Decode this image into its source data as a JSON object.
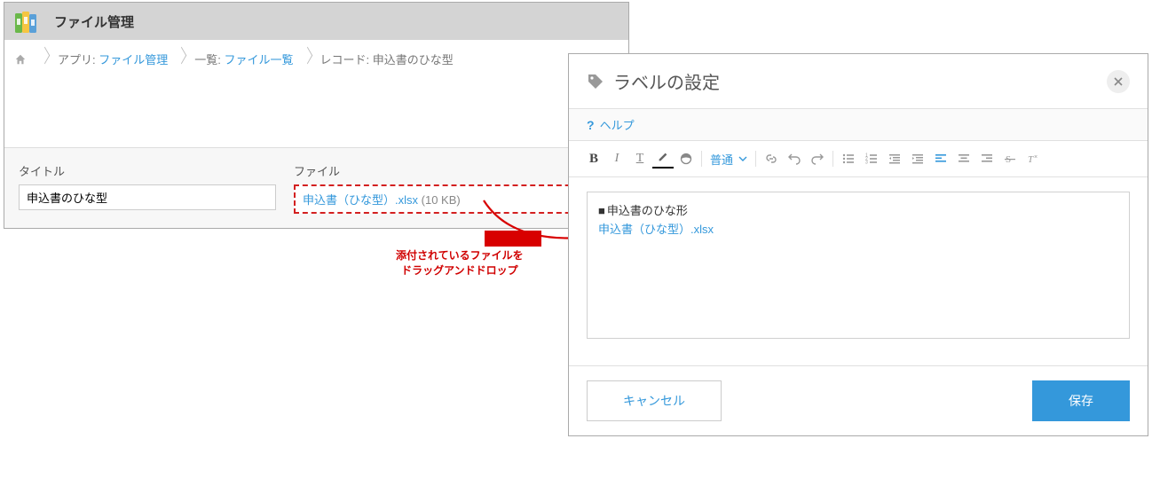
{
  "header": {
    "title": "ファイル管理"
  },
  "breadcrumb": {
    "app_label": "アプリ: ",
    "app_link": "ファイル管理",
    "list_label": "一覧: ",
    "list_link": "ファイル一覧",
    "record_label": "レコード: 申込書のひな型"
  },
  "form": {
    "title_label": "タイトル",
    "title_value": "申込書のひな型",
    "file_label": "ファイル",
    "file_name": "申込書（ひな型）.xlsx",
    "file_size": "(10 KB)"
  },
  "caption": {
    "line1": "添付されているファイルを",
    "line2": "ドラッグアンドドロップ"
  },
  "dialog": {
    "title": "ラベルの設定",
    "help": "ヘルプ",
    "font_size": "普通",
    "editor_line1": "申込書のひな形",
    "editor_line2": "申込書（ひな型）.xlsx",
    "cancel": "キャンセル",
    "save": "保存"
  },
  "toolbar_labels": {
    "b": "B",
    "i": "I",
    "u": "T",
    "help_q": "?"
  }
}
